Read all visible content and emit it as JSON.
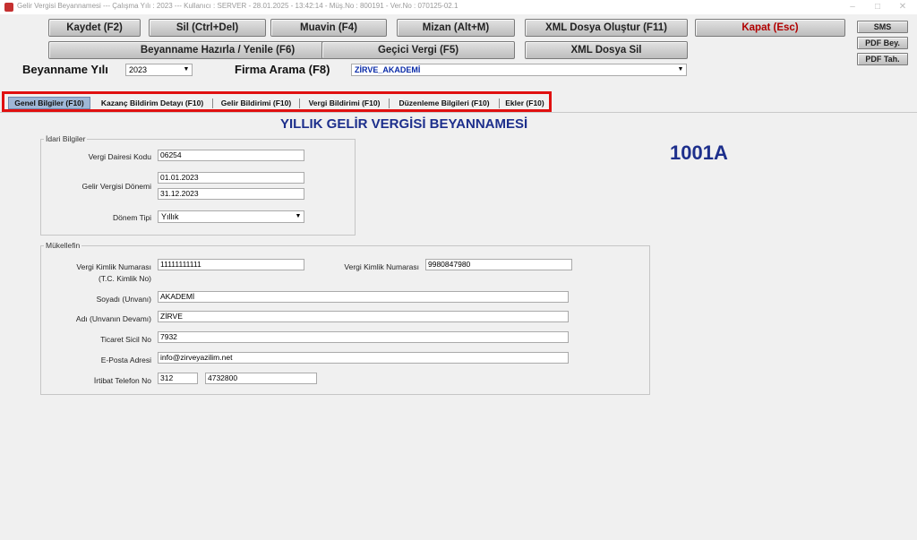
{
  "window": {
    "title": "Gelir Vergisi Beyannamesi  ---  Çalışma Yılı : 2023  ---  Kullanıcı : SERVER - 28.01.2025 - 13:42:14 - Müş.No : 800191 - Ver.No : 070125-02.1",
    "minimize": "–",
    "maximize": "□",
    "close": "✕"
  },
  "toolbar": {
    "kaydet": "Kaydet (F2)",
    "sil": "Sil (Ctrl+Del)",
    "muavin": "Muavin (F4)",
    "mizan": "Mizan (Alt+M)",
    "xml_olustur": "XML Dosya Oluştur (F11)",
    "kapat": "Kapat (Esc)",
    "beyanname_hazirla": "Beyanname Hazırla / Yenile (F6)",
    "gecici_vergi": "Geçici Vergi (F5)",
    "xml_sil": "XML Dosya Sil",
    "sms": "SMS",
    "pdf_bey": "PDF Bey.",
    "pdf_tah": "PDF Tah."
  },
  "filters": {
    "yil_label": "Beyanname Yılı",
    "yil_value": "2023",
    "firma_label": "Firma Arama (F8)",
    "firma_value": "ZİRVE_AKADEMİ"
  },
  "tabs": [
    {
      "label": "Genel Bilgiler (F10)",
      "active": true
    },
    {
      "label": "Kazanç Bildirim Detayı (F10)"
    },
    {
      "label": "Gelir Bildirimi (F10)"
    },
    {
      "label": "Vergi Bildirimi (F10)"
    },
    {
      "label": "Düzenleme Bilgileri (F10)"
    },
    {
      "label": "Ekler (F10)"
    }
  ],
  "form": {
    "title": "YILLIK GELİR VERGİSİ BEYANNAMESİ",
    "code": "1001A",
    "idari": {
      "legend": "İdari Bilgiler",
      "vergi_dairesi_label": "Vergi Dairesi Kodu",
      "vergi_dairesi_value": "06254",
      "donem_label": "Gelir Vergisi Dönemi",
      "donem_start": "01.01.2023",
      "donem_end": "31.12.2023",
      "donem_tipi_label": "Dönem Tipi",
      "donem_tipi_value": "Yıllık"
    },
    "mukellef": {
      "legend": "Mükellefin",
      "tckn_label": "Vergi Kimlik Numarası",
      "tckn_label2": "(T.C. Kimlik No)",
      "tckn_value": "11111111111",
      "vkn_label": "Vergi Kimlik Numarası",
      "vkn_value": "9980847980",
      "soyadi_label": "Soyadı (Unvanı)",
      "soyadi_value": "AKADEMİ",
      "adi_label": "Adı (Unvanın Devamı)",
      "adi_value": "ZİRVE",
      "sicil_label": "Ticaret Sicil No",
      "sicil_value": "7932",
      "eposta_label": "E-Posta Adresi",
      "eposta_value": "info@zirveyazilim.net",
      "telefon_label": "İrtibat Telefon No",
      "telefon_kod": "312",
      "telefon_no": "4732800"
    }
  }
}
